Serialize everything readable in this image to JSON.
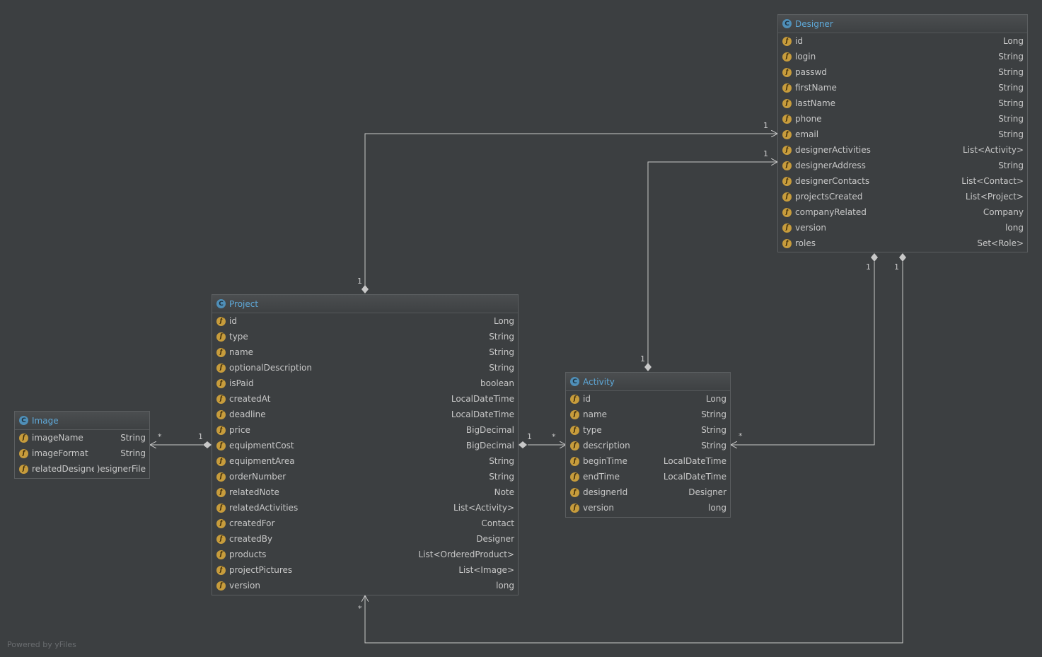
{
  "classes": {
    "designer": {
      "name": "Designer",
      "icon": "class-icon",
      "fields": [
        {
          "name": "id",
          "type": "Long"
        },
        {
          "name": "login",
          "type": "String"
        },
        {
          "name": "passwd",
          "type": "String"
        },
        {
          "name": "firstName",
          "type": "String"
        },
        {
          "name": "lastName",
          "type": "String"
        },
        {
          "name": "phone",
          "type": "String"
        },
        {
          "name": "email",
          "type": "String"
        },
        {
          "name": "designerActivities",
          "type": "List<Activity>"
        },
        {
          "name": "designerAddress",
          "type": "String"
        },
        {
          "name": "designerContacts",
          "type": "List<Contact>"
        },
        {
          "name": "projectsCreated",
          "type": "List<Project>"
        },
        {
          "name": "companyRelated",
          "type": "Company"
        },
        {
          "name": "version",
          "type": "long"
        },
        {
          "name": "roles",
          "type": "Set<Role>"
        }
      ]
    },
    "project": {
      "name": "Project",
      "icon": "class-icon",
      "fields": [
        {
          "name": "id",
          "type": "Long"
        },
        {
          "name": "type",
          "type": "String"
        },
        {
          "name": "name",
          "type": "String"
        },
        {
          "name": "optionalDescription",
          "type": "String"
        },
        {
          "name": "isPaid",
          "type": "boolean"
        },
        {
          "name": "createdAt",
          "type": "LocalDateTime"
        },
        {
          "name": "deadline",
          "type": "LocalDateTime"
        },
        {
          "name": "price",
          "type": "BigDecimal"
        },
        {
          "name": "equipmentCost",
          "type": "BigDecimal"
        },
        {
          "name": "equipmentArea",
          "type": "String"
        },
        {
          "name": "orderNumber",
          "type": "String"
        },
        {
          "name": "relatedNote",
          "type": "Note"
        },
        {
          "name": "relatedActivities",
          "type": "List<Activity>"
        },
        {
          "name": "createdFor",
          "type": "Contact"
        },
        {
          "name": "createdBy",
          "type": "Designer"
        },
        {
          "name": "products",
          "type": "List<OrderedProduct>"
        },
        {
          "name": "projectPictures",
          "type": "List<Image>"
        },
        {
          "name": "version",
          "type": "long"
        }
      ]
    },
    "activity": {
      "name": "Activity",
      "icon": "class-icon",
      "fields": [
        {
          "name": "id",
          "type": "Long"
        },
        {
          "name": "name",
          "type": "String"
        },
        {
          "name": "type",
          "type": "String"
        },
        {
          "name": "description",
          "type": "String"
        },
        {
          "name": "beginTime",
          "type": "LocalDateTime"
        },
        {
          "name": "endTime",
          "type": "LocalDateTime"
        },
        {
          "name": "designerId",
          "type": "Designer"
        },
        {
          "name": "version",
          "type": "long"
        }
      ]
    },
    "image": {
      "name": "Image",
      "icon": "class-icon",
      "fields": [
        {
          "name": "imageName",
          "type": "String"
        },
        {
          "name": "imageFormat",
          "type": "String"
        },
        {
          "name": "relatedDesignerFile",
          "type": ")esignerFile"
        }
      ]
    }
  },
  "icons": {
    "class": "C",
    "field": "f"
  },
  "multiplicities": {
    "project_designer_source": "1",
    "project_designer_target": "1",
    "activity_designer_source": "1",
    "activity_designer_target": "1",
    "designer_activity_source": "1",
    "designer_activity_target": "*",
    "designer_project_source": "1",
    "designer_project_target": "*",
    "project_image_source": "1",
    "project_image_target": "*",
    "project_activity_source": "1",
    "project_activity_target": "*"
  },
  "watermark": "Powered by yFiles",
  "colors": {
    "background": "#3c3f41",
    "edge": "#c8c8c8",
    "class_icon": "#4f8fb8",
    "field_icon": "#c79c3c",
    "class_name": "#5ea8d8"
  }
}
